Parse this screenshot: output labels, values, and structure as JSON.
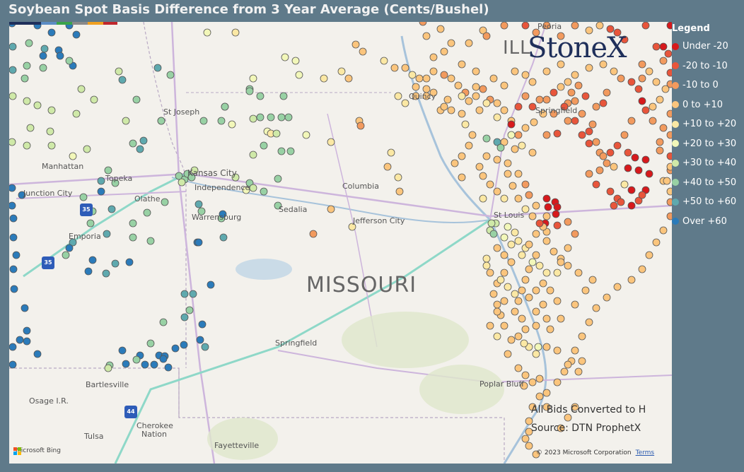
{
  "title": "Soybean Spot Basis Difference from 3 Year Average (Cents/Bushel)",
  "legend": {
    "title": "Legend",
    "items": [
      {
        "label": "Under -20",
        "color": "#d7191c"
      },
      {
        "label": "-20 to -10",
        "color": "#e8553b"
      },
      {
        "label": "-10 to 0",
        "color": "#f29a5e"
      },
      {
        "label": "0 to +10",
        "color": "#fbc57d"
      },
      {
        "label": "+10 to +20",
        "color": "#fbe8a4"
      },
      {
        "label": "+20 to +30",
        "color": "#f2f7b9"
      },
      {
        "label": "+30 to +40",
        "color": "#cfe9a8"
      },
      {
        "label": "+40 to +50",
        "color": "#98d1a4"
      },
      {
        "label": "+50 to +60",
        "color": "#5fa9ae"
      },
      {
        "label": "Over +60",
        "color": "#2b7bba"
      }
    ]
  },
  "map": {
    "state_label": "MISSOURI",
    "cities": [
      {
        "name": "St Joseph"
      },
      {
        "name": "Kansas City"
      },
      {
        "name": "Independence"
      },
      {
        "name": "Manhattan"
      },
      {
        "name": "Topeka"
      },
      {
        "name": "Junction City"
      },
      {
        "name": "Olathe"
      },
      {
        "name": "Emporia"
      },
      {
        "name": "Warrensburg"
      },
      {
        "name": "Sedalia"
      },
      {
        "name": "Columbia"
      },
      {
        "name": "Jefferson City"
      },
      {
        "name": "St Louis"
      },
      {
        "name": "Springfield"
      },
      {
        "name": "Springfield"
      },
      {
        "name": "Quincy"
      },
      {
        "name": "Peoria"
      },
      {
        "name": "Bartlesville"
      },
      {
        "name": "Osage I.R."
      },
      {
        "name": "Tulsa"
      },
      {
        "name": "Cherokee Nation"
      },
      {
        "name": "Fayetteville"
      },
      {
        "name": "Poplar Bluff"
      }
    ],
    "state_abbrev": "ILL",
    "notes": [
      "All Bids Converted to H",
      "Source: DTN ProphetX"
    ],
    "logo": "StoneX",
    "bing": "Microsoft Bing",
    "copyright": "© 2023 Microsoft Corporation",
    "terms": "Terms",
    "shields": [
      "35",
      "35",
      "44"
    ]
  }
}
